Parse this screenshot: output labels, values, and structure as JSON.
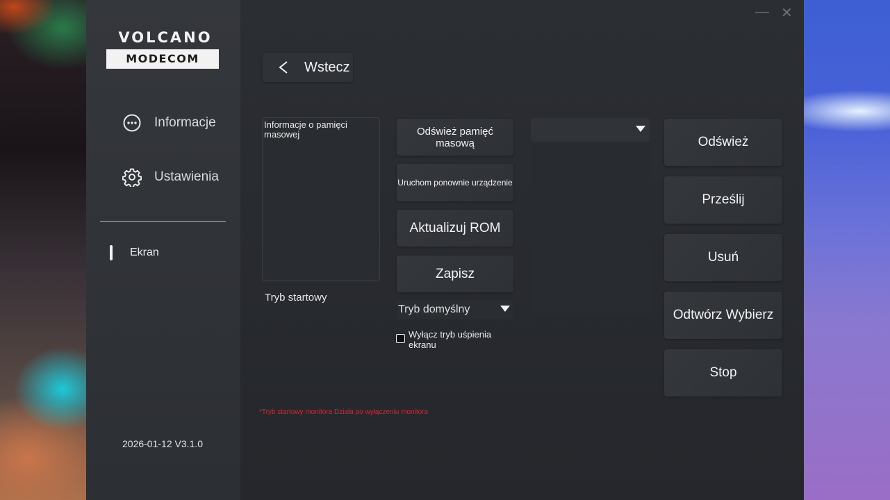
{
  "brand": {
    "logo_top": "VOLCANO",
    "logo_bottom": "MODECOM"
  },
  "sidebar": {
    "items": [
      {
        "label": "Informacje",
        "icon": "more-horizontal-circle-icon"
      },
      {
        "label": "Ustawienia",
        "icon": "gear-icon"
      }
    ],
    "active_item": {
      "label": "Ekran"
    },
    "version": "2026-01-12 V3.1.0"
  },
  "window_controls": {
    "minimize": "—",
    "close": "✕"
  },
  "main": {
    "back_label": "Wstecz",
    "info_box_title": "Informacje o pamięci masowej",
    "startup_label": "Tryb startowy",
    "middle_buttons": [
      "Odśwież pamięć masową",
      "Uruchom ponownie urządzenie",
      "Aktualizuj ROM",
      "Zapisz"
    ],
    "mode_select": {
      "value": "Tryb domyślny"
    },
    "sleep_checkbox": {
      "label": "Wyłącz tryb uśpienia ekranu",
      "checked": false
    },
    "right_buttons": [
      "Odśwież",
      "Prześlij",
      "Usuń",
      "Odtwórz Wybierz",
      "Stop"
    ],
    "note": "*Tryb startowy monitora Działa po wyłączeniu monitora"
  },
  "colors": {
    "note_red": "#e0242a",
    "panel": "#2b2e33",
    "sidebar": "#34373c"
  }
}
